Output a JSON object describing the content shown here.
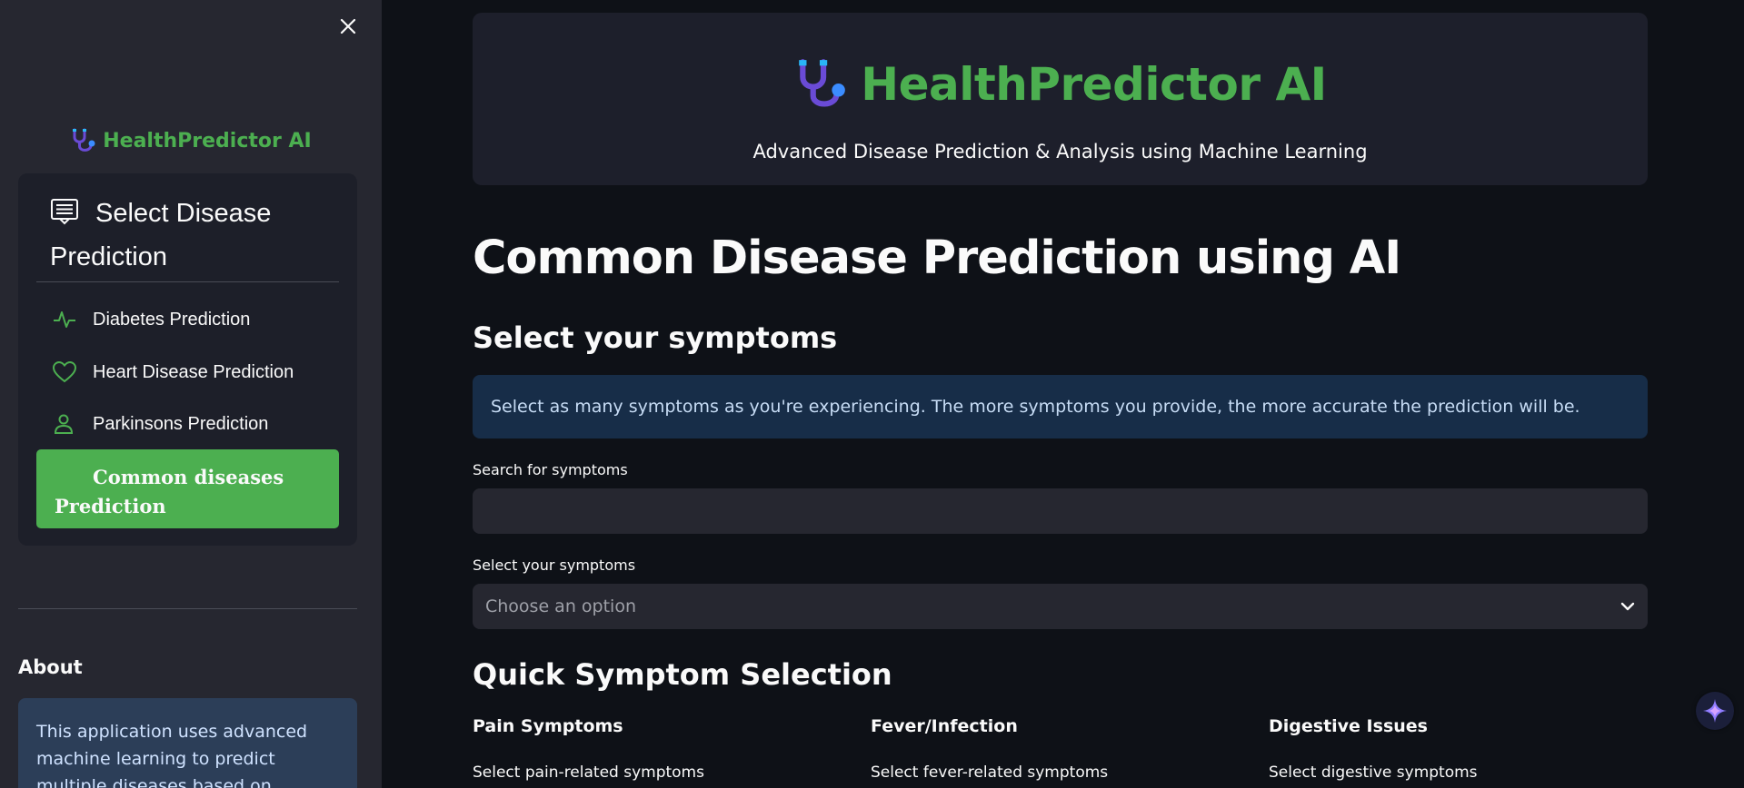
{
  "sidebar": {
    "brand": "HealthPredictor AI",
    "menu_title": "Select Disease Prediction",
    "items": [
      {
        "label": "Diabetes Prediction",
        "icon": "activity-icon"
      },
      {
        "label": "Heart Disease Prediction",
        "icon": "heart-icon"
      },
      {
        "label": "Parkinsons Prediction",
        "icon": "person-icon"
      },
      {
        "label": "Common diseases Prediction",
        "icon": "none",
        "active": true
      }
    ],
    "about_title": "About",
    "about_text": "This application uses advanced machine learning to predict multiple diseases based on symptoms and"
  },
  "header": {
    "title": "HealthPredictor AI",
    "subtitle": "Advanced Disease Prediction & Analysis using Machine Learning"
  },
  "main": {
    "page_title": "Common Disease Prediction using AI",
    "symptoms_heading": "Select your symptoms",
    "info_text": "Select as many symptoms as you're experiencing. The more symptoms you provide, the more accurate the prediction will be.",
    "search_label": "Search for symptoms",
    "search_value": "",
    "select_label": "Select your symptoms",
    "select_placeholder": "Choose an option",
    "quick_heading": "Quick Symptom Selection",
    "columns": [
      {
        "title": "Pain Symptoms",
        "subtitle": "Select pain-related symptoms"
      },
      {
        "title": "Fever/Infection",
        "subtitle": "Select fever-related symptoms"
      },
      {
        "title": "Digestive Issues",
        "subtitle": "Select digestive symptoms"
      }
    ]
  },
  "colors": {
    "accent": "#4caf50",
    "background": "#0e1117",
    "sidebar": "#262730",
    "info": "#172d48"
  }
}
